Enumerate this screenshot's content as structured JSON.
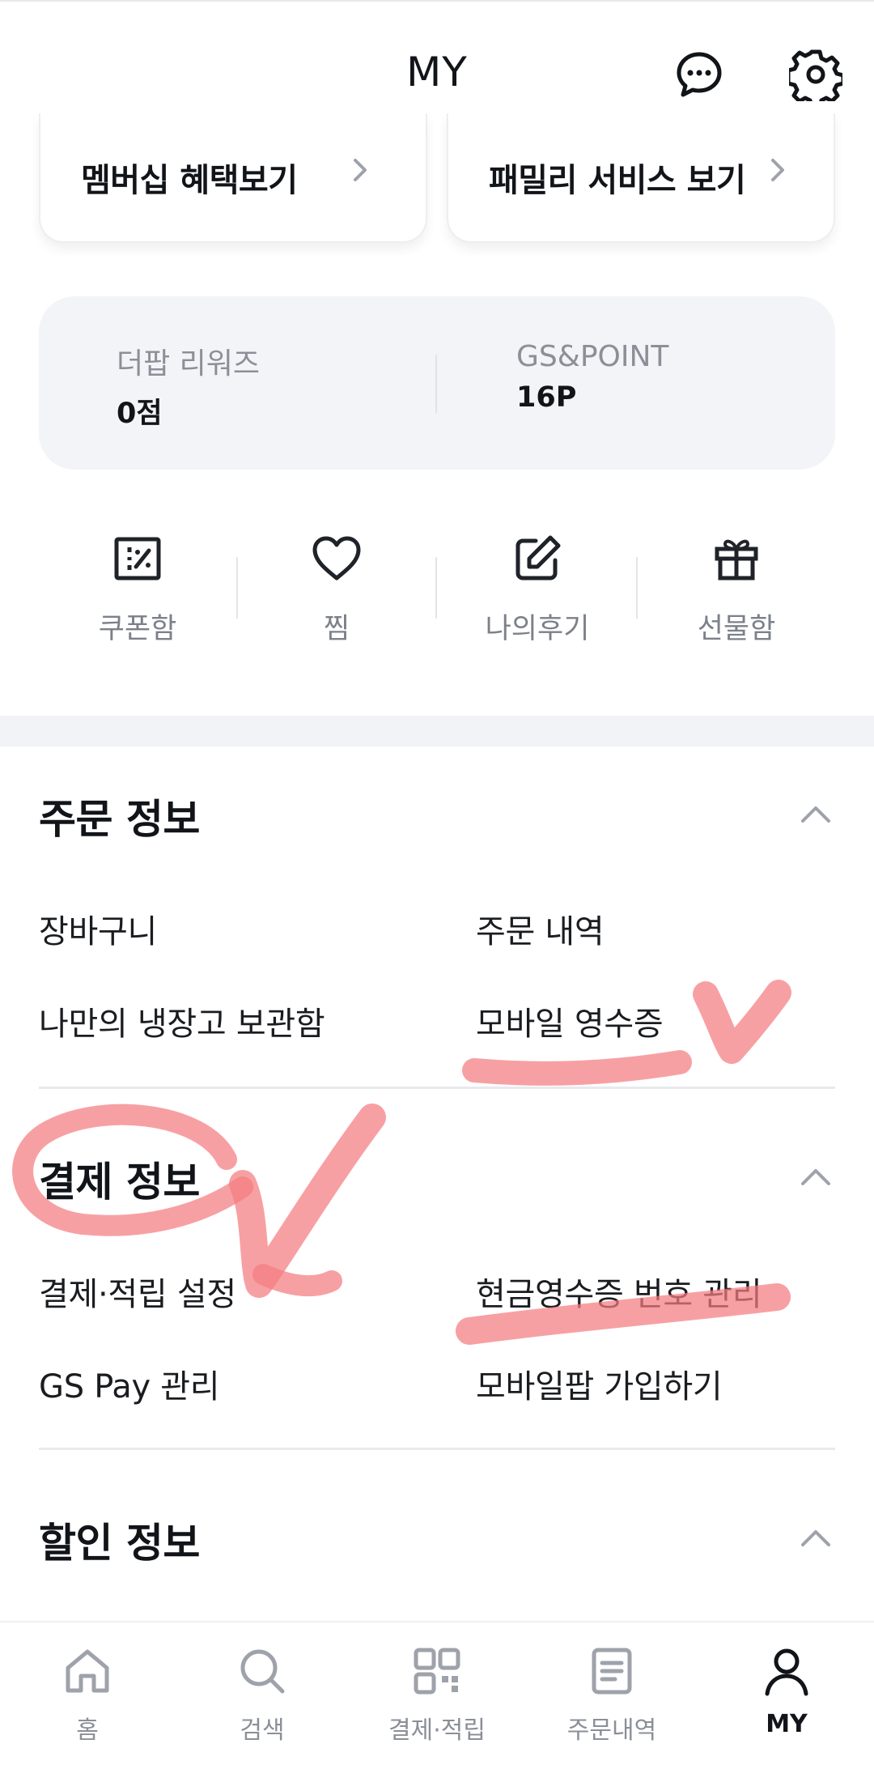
{
  "header": {
    "title": "MY"
  },
  "cards": [
    {
      "label": "멤버십 혜택보기"
    },
    {
      "label": "패밀리 서비스 보기"
    }
  ],
  "points": [
    {
      "label": "더팝 리워즈",
      "value": "0점"
    },
    {
      "label": "GS&POINT",
      "value": "16P"
    }
  ],
  "quick": [
    {
      "label": "쿠폰함",
      "icon": "coupon-icon"
    },
    {
      "label": "찜",
      "icon": "heart-icon"
    },
    {
      "label": "나의후기",
      "icon": "edit-icon"
    },
    {
      "label": "선물함",
      "icon": "gift-icon"
    }
  ],
  "sections": {
    "order": {
      "title": "주문 정보",
      "items": [
        "장바구니",
        "주문 내역",
        "나만의 냉장고 보관함",
        "모바일 영수증"
      ]
    },
    "payment": {
      "title": "결제 정보",
      "items": [
        "결제·적립 설정",
        "현금영수증 번호 관리",
        "GS Pay 관리",
        "모바일팝 가입하기"
      ]
    },
    "discount": {
      "title": "할인 정보"
    }
  },
  "nav": [
    {
      "label": "홈",
      "icon": "home-icon"
    },
    {
      "label": "검색",
      "icon": "search-icon"
    },
    {
      "label": "결제·적립",
      "icon": "qr-icon"
    },
    {
      "label": "주문내역",
      "icon": "document-icon"
    },
    {
      "label": "MY",
      "icon": "person-icon"
    }
  ],
  "colors": {
    "marker": "#f47b7f",
    "muted": "#8b8f97",
    "bg_soft": "#f2f4f8"
  }
}
